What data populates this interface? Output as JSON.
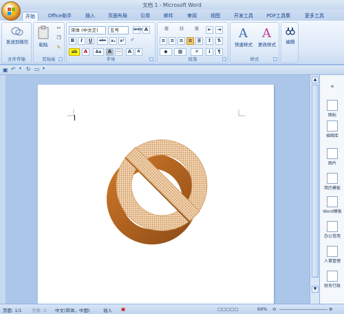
{
  "window": {
    "title": "文档 1 - Microsoft Word"
  },
  "tabs": [
    "开始",
    "Office助手",
    "插入",
    "页面布局",
    "引用",
    "邮件",
    "审阅",
    "视图",
    "开发工具",
    "PDF工具集",
    "更多工具"
  ],
  "ribbon": {
    "groups": {
      "doc_assist": "文件传输",
      "clipboard": "剪贴板",
      "font": "字体",
      "paragraph": "段落",
      "styles": "样式",
      "editing": ""
    },
    "send_to_wechat": "发送到微信",
    "paste": "粘贴",
    "font_name": "宋体 (中文正)",
    "font_size": "五号",
    "quick_styles": "快速样式",
    "change_styles": "更改样式",
    "edit": "编辑",
    "font_buttons": {
      "wen": "wén",
      "a_box": "A",
      "bold": "B",
      "italic": "I",
      "underline": "U",
      "strike": "abc",
      "subscript": "x₂",
      "superscript": "x²",
      "aa": "Aa",
      "char_shade": "A",
      "enclose": "㊀",
      "grow": "A",
      "shrink": "A"
    }
  },
  "sidepanel": {
    "collapse": "«",
    "items": [
      "图标",
      "插图库",
      "图片",
      "简历模板",
      "Word模板",
      "办公常用",
      "人事管理",
      "财务行政"
    ]
  },
  "statusbar": {
    "page": "页面: 1/1",
    "words": "字数: 0",
    "language": "中文(简体，中国)",
    "mode": "插入",
    "zoom": "69%"
  },
  "colors": {
    "accent": "#15428b",
    "ribbon": "#dbe8f7",
    "symbol_dark": "#b0651e",
    "symbol_light": "#e2b27c"
  }
}
